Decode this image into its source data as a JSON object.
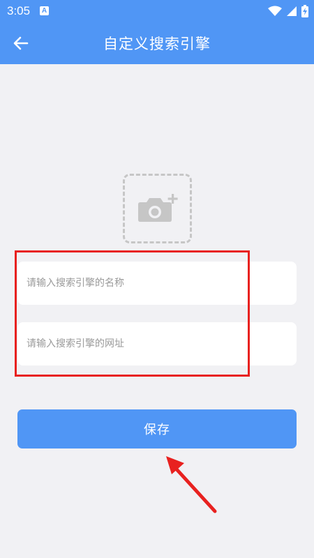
{
  "status_bar": {
    "time": "3:05",
    "notification_badge": "A",
    "icons": [
      "wifi-icon",
      "signal-icon",
      "battery-charging-icon"
    ]
  },
  "header": {
    "title": "自定义搜索引擎",
    "back_icon": "arrow-left-icon"
  },
  "photo_picker": {
    "icon": "camera-add-icon"
  },
  "form": {
    "name_placeholder": "请输入搜索引擎的名称",
    "name_value": "",
    "url_placeholder": "请输入搜索引擎的网址",
    "url_value": ""
  },
  "save_label": "保存",
  "colors": {
    "primary": "#5096f5",
    "background": "#f1f1f4",
    "annotation": "#e8211f",
    "dashed_border": "#c6c6c6",
    "placeholder": "#9a9a9a"
  }
}
